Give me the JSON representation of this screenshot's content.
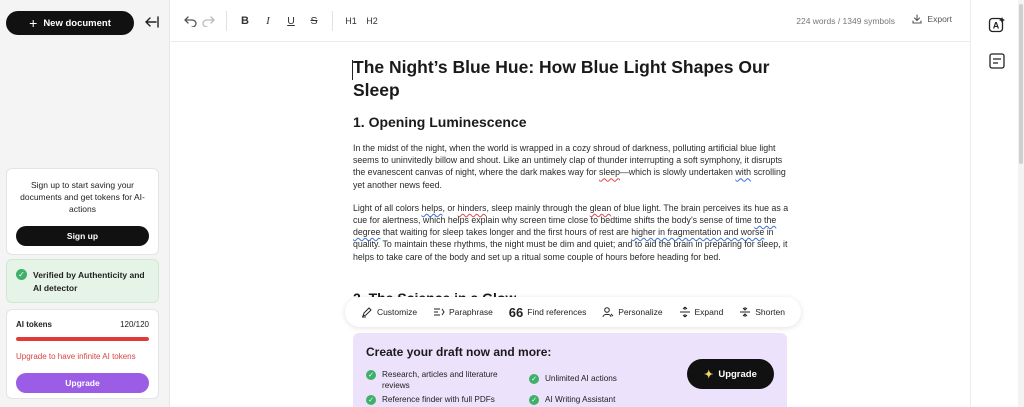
{
  "sidebar": {
    "new_document_label": "New document",
    "signup_card": {
      "message": "Sign up to start saving your documents and get tokens for AI-actions",
      "button_label": "Sign up"
    },
    "verified_card": {
      "text": "Verified by Authenticity and AI detector"
    },
    "tokens_card": {
      "label": "AI tokens",
      "count": "120/120",
      "fill_fraction": 1.0,
      "warning": "Upgrade to have infinite AI tokens",
      "button_label": "Upgrade"
    }
  },
  "toolbar": {
    "bold": "B",
    "italic": "I",
    "underline": "U",
    "strike": "S",
    "h1": "H1",
    "h2": "H2",
    "word_count": "224 words / 1349 symbols",
    "export_label": "Export"
  },
  "document": {
    "title": "The Night’s Blue Hue: How Blue Light Shapes Our Sleep",
    "section1_heading": "1. Opening Luminescence",
    "para1": {
      "a": "In the midst of the night, when the world is wrapped in a cozy shroud of darkness, polluting artificial blue light seems to uninvitedly billow and shout. Like an untimely clap of thunder interrupting a soft symphony, it disrupts the evanescent canvas of night, where the dark makes way for ",
      "b": "sleep",
      "c": "—which is slowly undertaken ",
      "d": "with",
      "e": " scrolling yet another news feed."
    },
    "para2": {
      "a": "Light of all colors ",
      "b": "helps",
      "c": ", or ",
      "d": "hinders",
      "e": ", sleep mainly through the ",
      "f": "glean",
      "g": " of blue light. The brain perceives its hue as a cue for alertness, which helps explain why screen time close to bedtime shifts the body’s sense of time ",
      "h": "to the degree",
      "i": " that waiting for sleep takes longer and the first hours of rest are ",
      "j": "higher in fragmentation and worse",
      "k": " in quality. To maintain these rhythms, the night must be dim and quiet; and to aid the brain in preparing for sleep, it helps to take care of the body and set up a ritual some couple of hours before heading for bed."
    },
    "section2_heading_partial": "2. The Science in a Glow"
  },
  "actionbar": {
    "customize": "Customize",
    "paraphrase": "Paraphrase",
    "find_references": "Find references",
    "personalize": "Personalize",
    "expand": "Expand",
    "shorten": "Shorten"
  },
  "promo": {
    "heading": "Create your draft now and more:",
    "features": [
      "Research, articles and literature reviews",
      "Unlimited AI actions",
      "Reference finder with full PDFs",
      "AI Writing Assistant"
    ],
    "button_label": "Upgrade"
  },
  "colors": {
    "accent_purple": "#9b5de5",
    "success_green": "#3fb06a",
    "danger_red": "#e03b3b",
    "promo_bg": "#ece2fb"
  }
}
